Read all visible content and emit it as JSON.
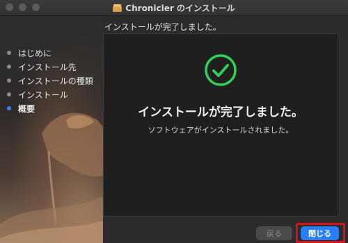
{
  "window": {
    "title": "Chronicler のインストール",
    "title_icon": "package-icon"
  },
  "step_title": "インストールが完了しました。",
  "sidebar": {
    "items": [
      {
        "label": "はじめに",
        "active": false
      },
      {
        "label": "インストール先",
        "active": false
      },
      {
        "label": "インストールの種類",
        "active": false
      },
      {
        "label": "インストール",
        "active": false
      },
      {
        "label": "概要",
        "active": true
      }
    ]
  },
  "panel": {
    "icon": "checkmark-circle-icon",
    "heading": "インストールが完了しました。",
    "subtext": "ソフトウェアがインストールされました。"
  },
  "buttons": {
    "back_label": "戻る",
    "close_label": "閉じる"
  },
  "colors": {
    "accent": "#2a7ef5",
    "success": "#30d158",
    "highlight": "#d6121b",
    "active_step_dot": "#2f86ff"
  }
}
